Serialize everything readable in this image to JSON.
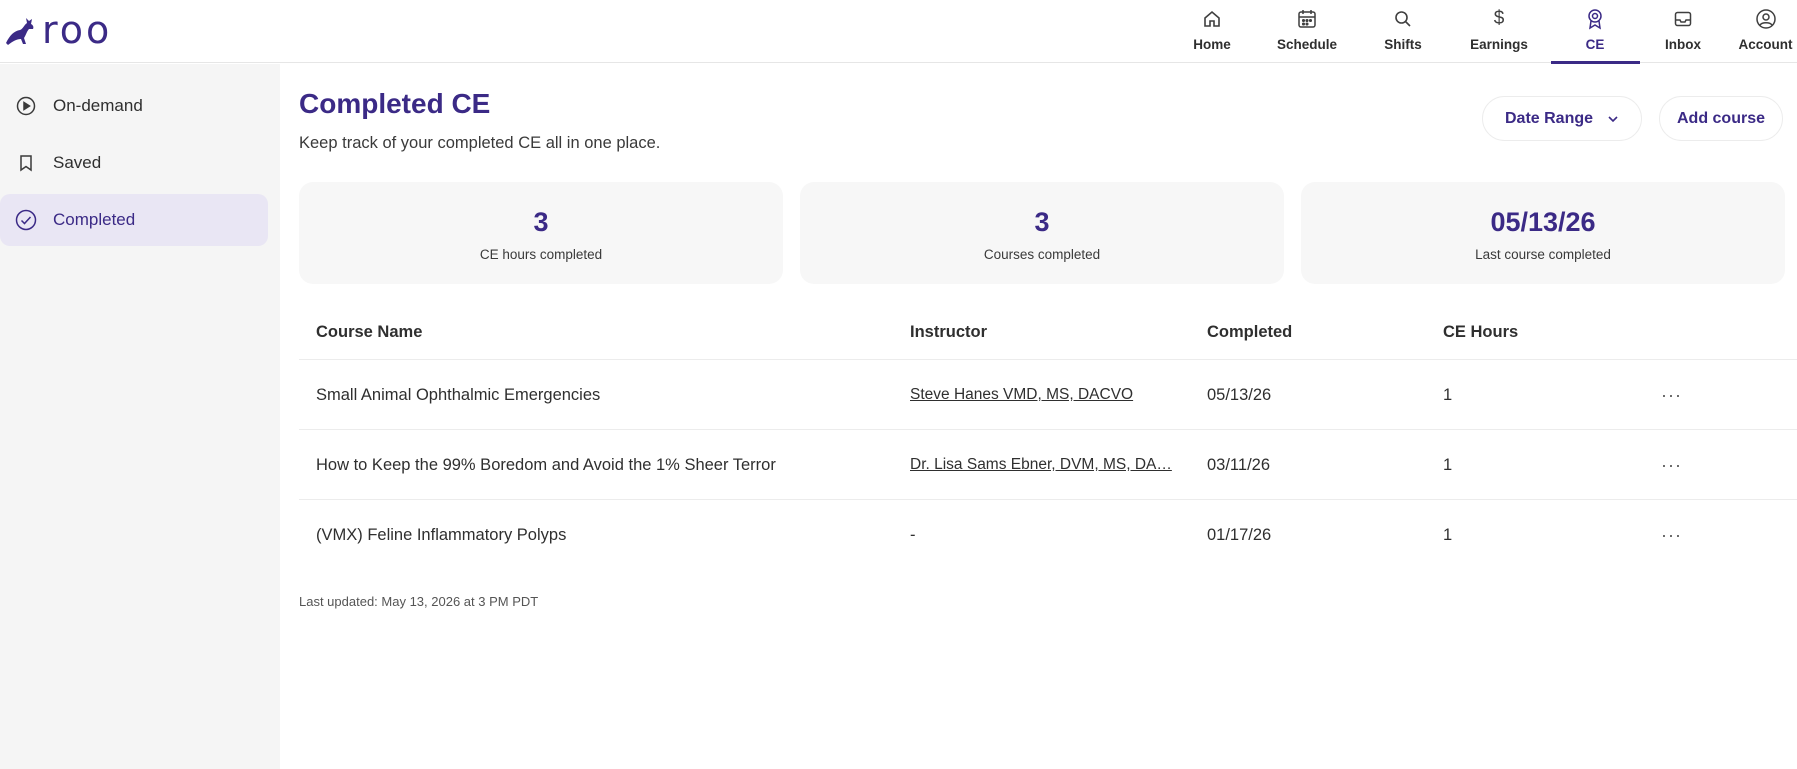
{
  "brand": {
    "name": "roo",
    "color": "#3b2a86"
  },
  "nav": [
    {
      "label": "Home",
      "icon": "home-icon"
    },
    {
      "label": "Schedule",
      "icon": "calendar-icon"
    },
    {
      "label": "Shifts",
      "icon": "search-icon"
    },
    {
      "label": "Earnings",
      "icon": "dollar-icon"
    },
    {
      "label": "CE",
      "icon": "ce-badge-icon",
      "active": true
    },
    {
      "label": "Inbox",
      "icon": "inbox-icon"
    },
    {
      "label": "Account",
      "icon": "account-icon"
    }
  ],
  "sidebar": {
    "items": [
      {
        "label": "On-demand",
        "icon": "play-circle-icon"
      },
      {
        "label": "Saved",
        "icon": "bookmark-icon"
      },
      {
        "label": "Completed",
        "icon": "check-circle-icon",
        "active": true
      }
    ]
  },
  "page": {
    "title": "Completed CE",
    "subtitle": "Keep track of your completed CE all in one place.",
    "date_range_label": "Date Range",
    "add_course_label": "Add course"
  },
  "stats": [
    {
      "value": "3",
      "caption": "CE hours completed"
    },
    {
      "value": "3",
      "caption": "Courses completed"
    },
    {
      "value": "05/13/26",
      "caption": "Last course completed"
    }
  ],
  "table": {
    "headers": [
      "Course Name",
      "Instructor",
      "Completed",
      "CE Hours"
    ],
    "rows": [
      {
        "course": "Small Animal Ophthalmic Emergencies",
        "instructor": "Steve Hanes VMD, MS, DACVO",
        "completed": "05/13/26",
        "hours": "1",
        "more": "···"
      },
      {
        "course": "How to Keep the 99% Boredom and Avoid the 1% Sheer Terror",
        "instructor": "Dr. Lisa Sams Ebner, DVM, MS, DA…",
        "completed": "03/11/26",
        "hours": "1",
        "more": "···"
      },
      {
        "course": "(VMX) Feline Inflammatory Polyps",
        "instructor": "-",
        "completed": "01/17/26",
        "hours": "1",
        "more": "···"
      }
    ]
  },
  "last_updated": "Last updated: May 13, 2026 at 3 PM PDT"
}
